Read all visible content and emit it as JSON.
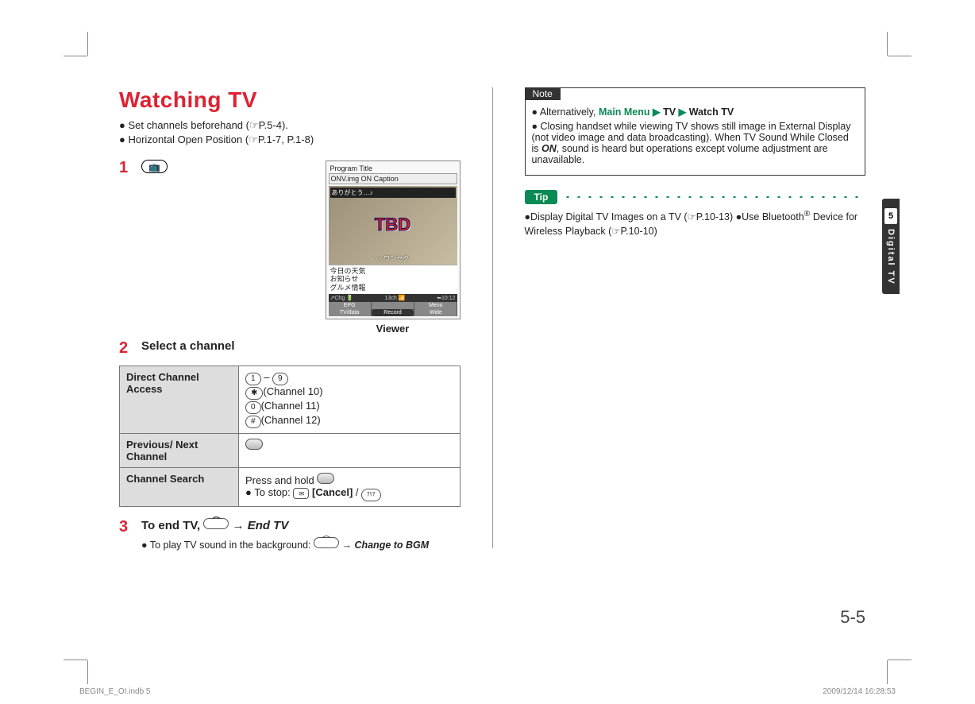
{
  "title": "Watching TV",
  "intro_bullets": [
    "Set channels beforehand (☞P.5-4).",
    "Horizontal Open Position (☞P.1-7, P.1-8)"
  ],
  "viewer": {
    "label": "Viewer",
    "program_title": "Program Title",
    "overlay_top": "ONV.img ON Caption",
    "caption": "ありがとう…♪",
    "tbd": "TBD",
    "sub": "○○ワンセグ",
    "list": [
      "今日の天気",
      "お知らせ",
      "グルメ情報"
    ],
    "statusbar": {
      "l": "↗Chg 🔋",
      "c": "13ch 📶",
      "r": "⬅10:12"
    },
    "softkeys": {
      "tl": "EPG",
      "tr": "Menu",
      "bl": "TV/data",
      "mid": "Record",
      "br": "Wide"
    }
  },
  "step1": {
    "num": "1"
  },
  "step2": {
    "num": "2",
    "title": "Select a channel"
  },
  "step3": {
    "num": "3",
    "prefix": "To end TV, ",
    "arrow": " → ",
    "action": "End TV",
    "sub_prefix": "To play TV sound in the background: ",
    "sub_action": "Change to BGM"
  },
  "table": {
    "r1h": "Direct Channel Access",
    "r1c_dash": " – ",
    "r1c_ch10": "(Channel 10)",
    "r1c_ch11": "(Channel 11)",
    "r1c_ch12": "(Channel 12)",
    "r2h": "Previous/ Next Channel",
    "r3h": "Channel Search",
    "r3c_pre": "Press and hold ",
    "r3c_stop": "To stop: ",
    "r3c_cancel": "[Cancel]",
    "r3c_slash": " / "
  },
  "note": {
    "label": "Note",
    "alt_prefix": "Alternatively, ",
    "path1": "Main Menu",
    "path2": "TV",
    "path3": "Watch TV",
    "item2a": "Closing handset while viewing TV shows still image in External Display (not video image and data broadcasting). When TV Sound While Closed is ",
    "on": "ON",
    "item2b": ", sound is heard but operations except volume adjustment are unavailable."
  },
  "tip": {
    "label": "Tip",
    "t1": "●Display Digital TV Images on a TV (☞P.10-13) ●Use Bluetooth",
    "reg": "®",
    "t2": " Device for Wireless Playback (☞P.10-10)"
  },
  "side": {
    "chapter": "5",
    "label": "Digital TV"
  },
  "page_num": "5-5",
  "footer": {
    "left": "BEGIN_E_OI.indb   5",
    "right": "2009/12/14   16:28:53"
  }
}
